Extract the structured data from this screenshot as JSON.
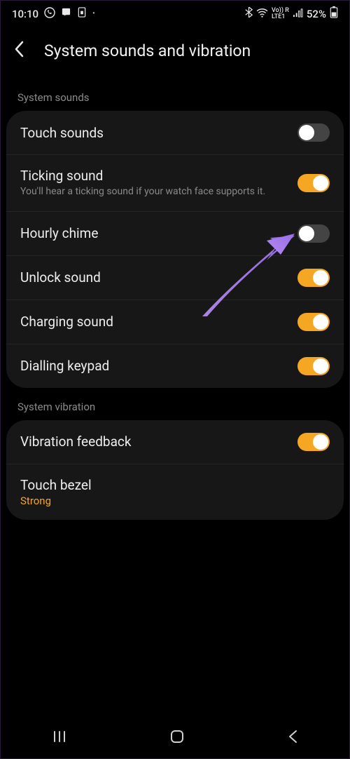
{
  "status_bar": {
    "time": "10:10",
    "battery_pct": "52%"
  },
  "header": {
    "title": "System sounds and vibration"
  },
  "sections": {
    "sounds_label": "System sounds",
    "vibration_label": "System vibration"
  },
  "sounds_rows": [
    {
      "title": "Touch sounds",
      "sub": "",
      "on": false
    },
    {
      "title": "Ticking sound",
      "sub": "You'll hear a ticking sound if your watch face supports it.",
      "on": true
    },
    {
      "title": "Hourly chime",
      "sub": "",
      "on": false
    },
    {
      "title": "Unlock sound",
      "sub": "",
      "on": true
    },
    {
      "title": "Charging sound",
      "sub": "",
      "on": true
    },
    {
      "title": "Dialling keypad",
      "sub": "",
      "on": true
    }
  ],
  "vibration_rows": [
    {
      "title": "Vibration feedback",
      "sub": "",
      "on": true
    },
    {
      "title": "Touch bezel",
      "value": "Strong"
    }
  ],
  "colors": {
    "accent": "#f5a623",
    "card": "#171717",
    "bg": "#000000",
    "annotation": "#a87fe8"
  }
}
